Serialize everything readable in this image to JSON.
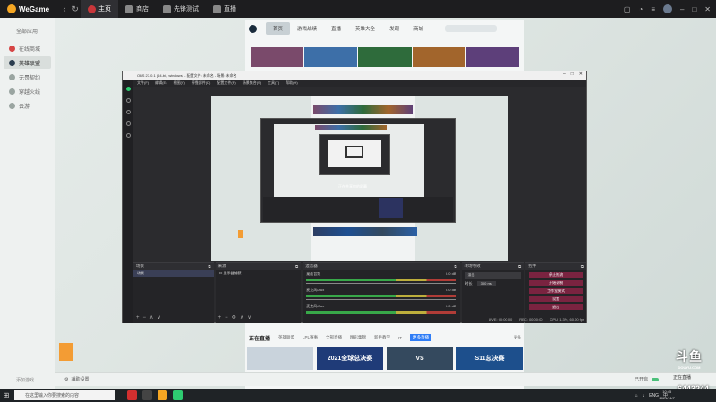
{
  "wegame": {
    "brand": "WeGame",
    "tabs": [
      {
        "label": "主页",
        "active": true
      },
      {
        "label": "商店",
        "active": false
      },
      {
        "label": "先锋测试",
        "active": false
      },
      {
        "label": "直播",
        "active": false
      }
    ]
  },
  "sidebar": {
    "header": "全部应用",
    "items": [
      {
        "label": "在线商城"
      },
      {
        "label": "英雄联盟"
      },
      {
        "label": "无畏契约"
      },
      {
        "label": "穿越火线"
      },
      {
        "label": "云游"
      }
    ],
    "footer": "添加游戏"
  },
  "lol": {
    "nav": [
      "首页",
      "游戏战绩",
      "直播",
      "英雄大全",
      "发现",
      "商城"
    ],
    "live": {
      "title": "正在直播",
      "tabs": [
        "英雄联盟",
        "LPL赛事",
        "全部直播",
        "精彩集锦",
        "新手教学",
        "IT",
        "更多直播"
      ],
      "more": "更多",
      "thumbs": [
        "2021全球总决赛",
        "VS",
        "S11总决赛"
      ]
    }
  },
  "obs": {
    "title": "OBS 27.0.1 (64-bit, windows) - 配置文件: 未命名 - 场景: 未命名",
    "menu": [
      "文件(F)",
      "编辑(E)",
      "视图(V)",
      "停靠部件(D)",
      "配置文件(P)",
      "场景集合(S)",
      "工具(T)",
      "帮助(H)"
    ],
    "docks": {
      "scenes": {
        "title": "场景",
        "items": [
          "场景"
        ]
      },
      "sources": {
        "title": "来源",
        "items": [
          "显示器捕获"
        ]
      },
      "mixer": {
        "title": "混音器",
        "rows": [
          {
            "name": "桌面音频",
            "db": "0.0 dB"
          },
          {
            "name": "麦克风/Aux",
            "db": "0.0 dB"
          },
          {
            "name": "麦克风/Aux",
            "db": "0.0 dB"
          }
        ]
      },
      "transitions": {
        "title": "转场特效",
        "fade": "淡出",
        "duration_label": "时长",
        "duration": "300 ms"
      },
      "controls": {
        "title": "控件",
        "buttons": [
          "停止推流",
          "开始录制",
          "工作室模式",
          "设置",
          "退出"
        ]
      }
    },
    "status": [
      "LIVE: 00:00:00",
      "REC: 00:00:00",
      "CPU: 1.3%, 60.00 fps"
    ],
    "preview_caption": "正在共享你的屏幕"
  },
  "footer": {
    "left": "辅助设置",
    "right": "正在直播",
    "right_extra": "已开启"
  },
  "douyu": {
    "logo": "斗鱼",
    "domain": "DOUYU.COM",
    "room_id": "6443244"
  },
  "taskbar": {
    "search_placeholder": "在这里输入你要搜索的内容",
    "tray": [
      "ENG",
      "中"
    ],
    "time": "10:45",
    "date": "2021/11/7"
  }
}
